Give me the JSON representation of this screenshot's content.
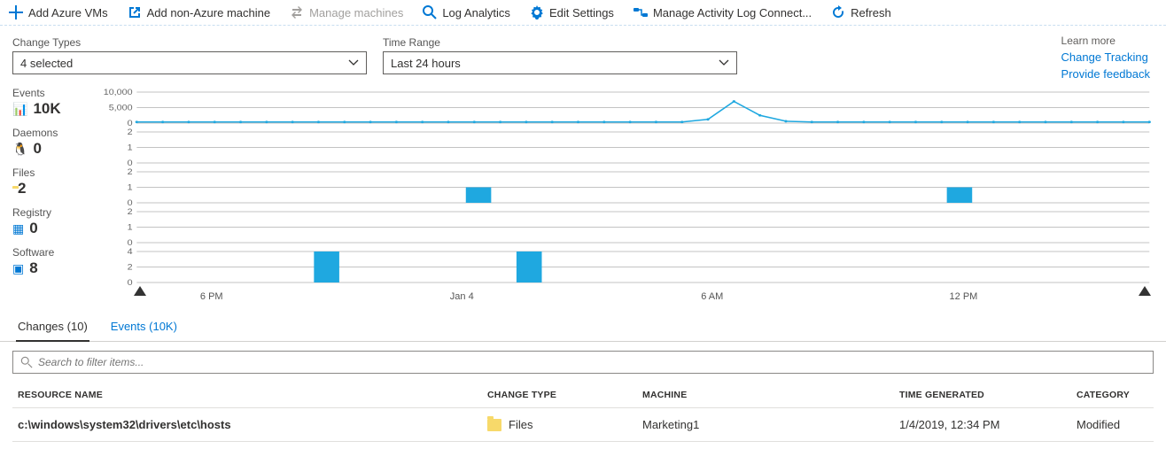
{
  "toolbar": {
    "add_vms": "Add Azure VMs",
    "add_non_azure": "Add non-Azure machine",
    "manage_machines": "Manage machines",
    "log_analytics": "Log Analytics",
    "edit_settings": "Edit Settings",
    "manage_activity": "Manage Activity Log Connect...",
    "refresh": "Refresh"
  },
  "controls": {
    "change_types_label": "Change Types",
    "change_types_value": "4 selected",
    "time_range_label": "Time Range",
    "time_range_value": "Last 24 hours"
  },
  "learn_more": {
    "title": "Learn more",
    "link_tracking": "Change Tracking",
    "link_feedback": "Provide feedback"
  },
  "metrics": {
    "events": {
      "name": "Events",
      "value": "10K"
    },
    "daemons": {
      "name": "Daemons",
      "value": "0"
    },
    "files": {
      "name": "Files",
      "value": "2"
    },
    "registry": {
      "name": "Registry",
      "value": "0"
    },
    "software": {
      "name": "Software",
      "value": "8"
    }
  },
  "chart_data": [
    {
      "type": "line",
      "name": "Events",
      "ylim": [
        0,
        10000
      ],
      "yticks": [
        "0",
        "5,000",
        "10,000"
      ],
      "x": [
        0,
        1,
        2,
        3,
        4,
        5,
        6,
        7,
        8,
        9,
        10,
        11,
        12,
        13,
        14,
        15,
        16,
        17,
        18,
        19,
        20,
        21,
        22,
        23,
        24,
        25,
        26,
        27,
        28,
        29,
        30,
        31,
        32,
        33,
        34,
        35,
        36,
        37,
        38,
        39
      ],
      "y": [
        350,
        350,
        350,
        350,
        350,
        350,
        350,
        350,
        350,
        350,
        350,
        350,
        350,
        350,
        350,
        350,
        350,
        350,
        350,
        350,
        350,
        350,
        1200,
        7000,
        2500,
        600,
        350,
        350,
        350,
        350,
        350,
        350,
        350,
        350,
        350,
        350,
        350,
        350,
        350,
        350
      ]
    },
    {
      "type": "bar",
      "name": "Daemons",
      "ylim": [
        0,
        2
      ],
      "yticks": [
        "0",
        "1",
        "2"
      ],
      "categories": [],
      "values": []
    },
    {
      "type": "bar",
      "name": "Files",
      "ylim": [
        0,
        2
      ],
      "yticks": [
        "0",
        "1",
        "2"
      ],
      "categories": [
        13,
        32
      ],
      "values": [
        1,
        1
      ]
    },
    {
      "type": "bar",
      "name": "Registry",
      "ylim": [
        0,
        2
      ],
      "yticks": [
        "0",
        "1",
        "2"
      ],
      "categories": [],
      "values": []
    },
    {
      "type": "bar",
      "name": "Software",
      "ylim": [
        0,
        4
      ],
      "yticks": [
        "0",
        "2",
        "4"
      ],
      "categories": [
        7,
        15
      ],
      "values": [
        4,
        4
      ]
    }
  ],
  "x_axis": {
    "ticks": [
      {
        "label": "6 PM",
        "pos": 10.8
      },
      {
        "label": "Jan 4",
        "pos": 34.5
      },
      {
        "label": "6 AM",
        "pos": 58.2
      },
      {
        "label": "12 PM",
        "pos": 82.0
      }
    ]
  },
  "tabs": {
    "changes": "Changes (10)",
    "events": "Events (10K)"
  },
  "search": {
    "placeholder": "Search to filter items..."
  },
  "table": {
    "headers": {
      "resource": "RESOURCE NAME",
      "change_type": "CHANGE TYPE",
      "machine": "MACHINE",
      "time": "TIME GENERATED",
      "category": "CATEGORY"
    },
    "rows": [
      {
        "resource": "c:\\windows\\system32\\drivers\\etc\\hosts",
        "change_type": "Files",
        "machine": "Marketing1",
        "time": "1/4/2019, 12:34 PM",
        "category": "Modified"
      }
    ]
  }
}
